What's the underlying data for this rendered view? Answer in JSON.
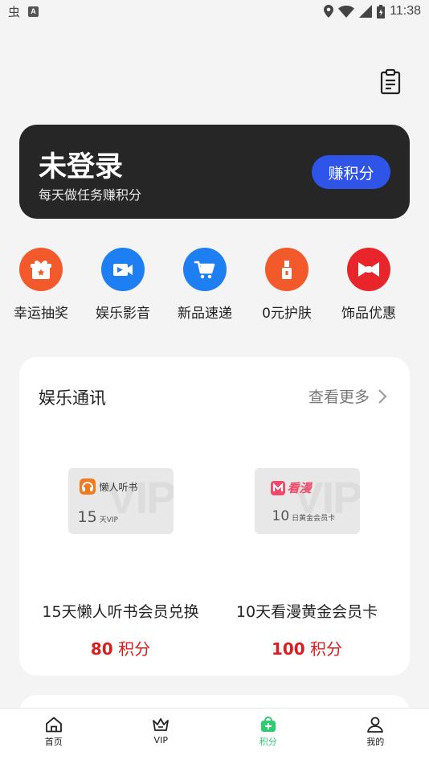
{
  "status_bar": {
    "left_glyph": "虫",
    "left_badge": "A",
    "time": "11:38"
  },
  "header": {
    "clipboard_icon": "clipboard-list-icon"
  },
  "login_card": {
    "title": "未登录",
    "subtitle": "每天做任务赚积分",
    "button_label": "赚积分",
    "button_color": "#2f55e8"
  },
  "quick_actions": [
    {
      "label": "幸运抽奖",
      "icon": "gift-icon",
      "color": "#f25a2b"
    },
    {
      "label": "娱乐影音",
      "icon": "video-icon",
      "color": "#1e7ff2"
    },
    {
      "label": "新品速递",
      "icon": "cart-icon",
      "color": "#1e7ff2"
    },
    {
      "label": "0元护肤",
      "icon": "lipstick-icon",
      "color": "#f25a2b"
    },
    {
      "label": "饰品优惠",
      "icon": "bowtie-icon",
      "color": "#e8252b"
    }
  ],
  "entertainment": {
    "title": "娱乐通讯",
    "more_label": "查看更多",
    "products": [
      {
        "brand": "懒人听书",
        "days": "15",
        "unit": "天VIP",
        "name": "15天懒人听书会员兑换",
        "points": "80",
        "points_unit": "积分"
      },
      {
        "brand": "看漫",
        "days": "10",
        "unit": "日黄金会员卡",
        "name": "10天看漫黄金会员卡",
        "points": "100",
        "points_unit": "积分"
      }
    ]
  },
  "bottom_nav": [
    {
      "label": "首页",
      "icon": "home-icon",
      "active": false
    },
    {
      "label": "VIP",
      "icon": "crown-icon",
      "active": false
    },
    {
      "label": "积分",
      "icon": "points-bag-icon",
      "active": true
    },
    {
      "label": "我的",
      "icon": "user-icon",
      "active": false
    }
  ],
  "colors": {
    "accent_green": "#2ecc71",
    "price_red": "#d81e1e",
    "dark_card": "#262626"
  }
}
